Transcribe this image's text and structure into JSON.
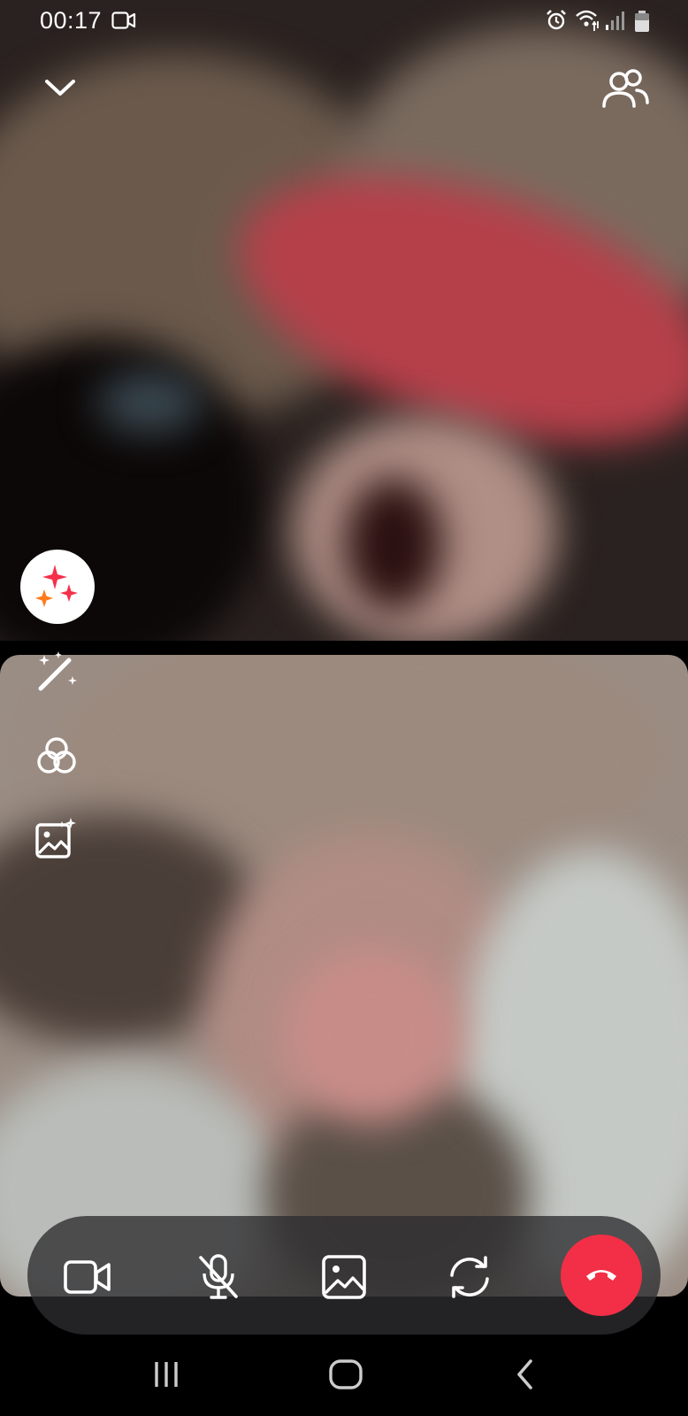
{
  "status_bar": {
    "time": "00:17",
    "icons": [
      "video-recording-icon",
      "alarm-icon",
      "wifi-icon",
      "signal-icon",
      "battery-icon"
    ]
  },
  "header": {
    "icons": [
      "chevron-down-icon",
      "participants-icon"
    ]
  },
  "video": {
    "remote_feed_icon": "remote-video-feed",
    "local_feed_icon": "local-video-feed"
  },
  "effects": {
    "icons": [
      "sparkles-icon",
      "magic-wand-icon",
      "color-filter-icon",
      "background-icon"
    ],
    "sparkle_colors": [
      "#f5304a",
      "#ff7a1a"
    ]
  },
  "call_controls": {
    "icons": [
      "video-camera-icon",
      "microphone-off-icon",
      "image-icon",
      "switch-camera-icon",
      "end-call-icon"
    ],
    "end_call_color": "#f22f46"
  },
  "nav_bar": {
    "icons": [
      "recent-apps-icon",
      "home-icon",
      "back-icon"
    ]
  }
}
